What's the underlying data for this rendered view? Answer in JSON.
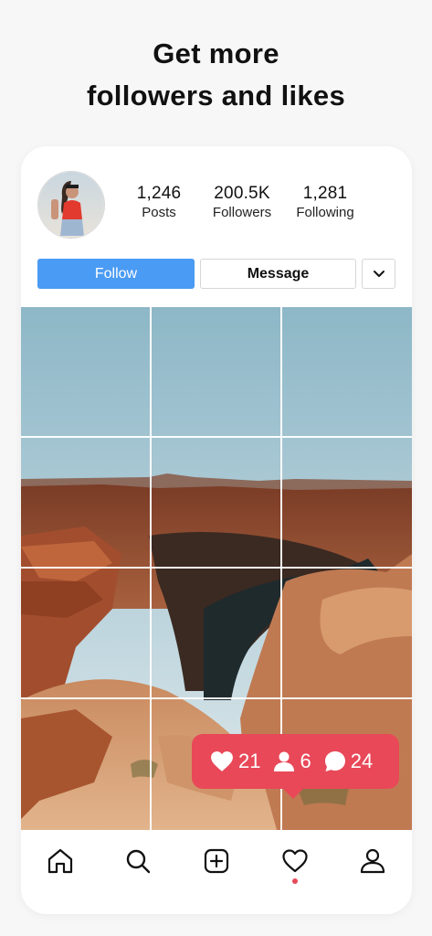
{
  "headline": {
    "line1": "Get more",
    "line2": "followers and likes"
  },
  "profile": {
    "stats": [
      {
        "value": "1,246",
        "label": "Posts"
      },
      {
        "value": "200.5K",
        "label": "Followers"
      },
      {
        "value": "1,281",
        "label": "Following"
      }
    ],
    "follow_label": "Follow",
    "message_label": "Message"
  },
  "notification": {
    "likes": "21",
    "followers": "6",
    "comments": "24"
  },
  "colors": {
    "accent_blue": "#4a9bf3",
    "notification_red": "#e84858"
  },
  "tabbar": [
    "home-icon",
    "search-icon",
    "add-icon",
    "heart-icon",
    "profile-icon"
  ]
}
